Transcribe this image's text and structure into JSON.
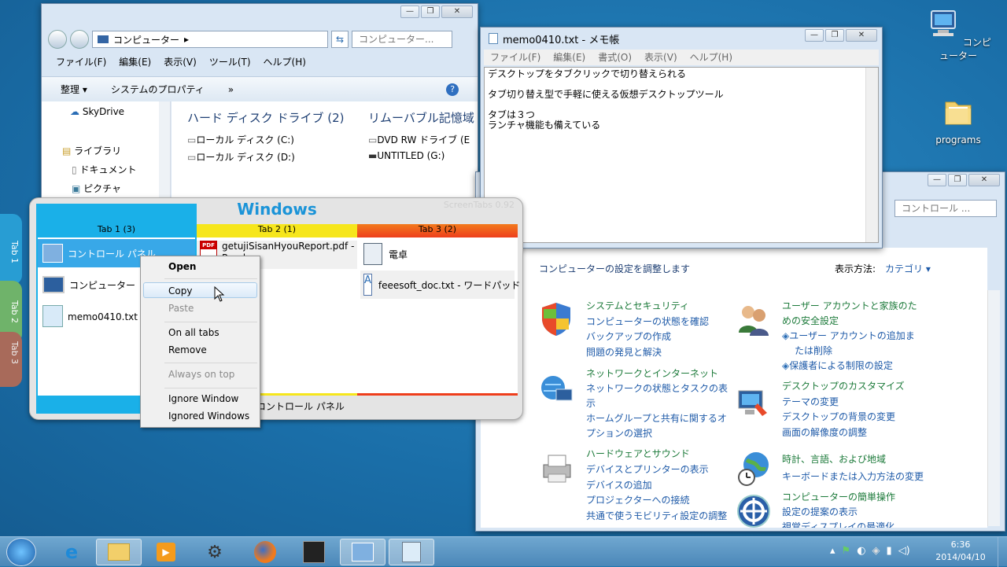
{
  "desktop": {
    "icons": [
      {
        "label": "コンピューター",
        "icon": "computer-icon"
      },
      {
        "label": "programs",
        "icon": "folder-icon"
      }
    ]
  },
  "explorer": {
    "address": "コンピューター",
    "address_arrow": "▸",
    "search_placeholder": "コンピューター...",
    "menu": [
      "ファイル(F)",
      "編集(E)",
      "表示(V)",
      "ツール(T)",
      "ヘルプ(H)"
    ],
    "toolbar": {
      "organize": "整理 ▾",
      "system_props": "システムのプロパティ",
      "more": "»"
    },
    "nav": [
      "SkyDrive",
      "ライブラリ",
      "ドキュメント",
      "ピクチャ"
    ],
    "groups": [
      {
        "title": "ハード ディスク ドライブ (2)",
        "items": [
          "ローカル ディスク (C:)",
          "ローカル ディスク (D:)"
        ]
      },
      {
        "title": "リムーバブル記憶域",
        "items": [
          "DVD RW ドライブ (E",
          "UNTITLED (G:)"
        ]
      }
    ]
  },
  "notepad": {
    "title": "memo0410.txt - メモ帳",
    "menu": [
      "ファイル(F)",
      "編集(E)",
      "書式(O)",
      "表示(V)",
      "ヘルプ(H)"
    ],
    "lines": [
      "デスクトップをタブクリックで切り替えられる",
      "",
      "タブ切り替え型で手軽に使える仮想デスクトップツール",
      "",
      "タブは３つ",
      "ランチャ機能も備えている"
    ]
  },
  "control_panel": {
    "search_placeholder": "コントロール ...",
    "heading": "コンピューターの設定を調整します",
    "view_label": "表示方法:",
    "view_value": "カテゴリ ▾",
    "left": [
      {
        "title": "システムとセキュリティ",
        "links": [
          "コンピューターの状態を確認",
          "バックアップの作成",
          "問題の発見と解決"
        ]
      },
      {
        "title": "ネットワークとインターネット",
        "links": [
          "ネットワークの状態とタスクの表",
          "示",
          "ホームグループと共有に関するオ",
          "プションの選択"
        ]
      },
      {
        "title": "ハードウェアとサウンド",
        "links": [
          "デバイスとプリンターの表示",
          "デバイスの追加",
          "プロジェクターへの接続",
          "共通で使うモビリティ設定の調整"
        ]
      }
    ],
    "right": [
      {
        "title": "ユーザー アカウントと家族のた",
        "title2": "めの安全設定",
        "links": [
          "ユーザー アカウントの追加ま",
          "たは削除",
          "保護者による制限の設定"
        ]
      },
      {
        "title": "デスクトップのカスタマイズ",
        "links": [
          "テーマの変更",
          "デスクトップの背景の変更",
          "画面の解像度の調整"
        ]
      },
      {
        "title": "時計、言語、および地域",
        "links": [
          "キーボードまたは入力方法の変更"
        ]
      },
      {
        "title": "コンピューターの簡単操作",
        "links": [
          "設定の提案の表示",
          "視覚ディスプレイの最適化"
        ]
      }
    ]
  },
  "screentabs": {
    "title": "Windows",
    "version": "ScreenTabs 0.92",
    "tabs": [
      {
        "label": "Tab 1 (3)",
        "color": "#1ab0e8",
        "items": [
          "コントロール パネル",
          "コンピューター",
          "memo0410.txt - メ"
        ]
      },
      {
        "label": "Tab 2 (1)",
        "color": "#f6e61c",
        "items": [
          "getujiSisanHyouReport.pdf -",
          "Reader"
        ]
      },
      {
        "label": "Tab 3 (2)",
        "color": "#f2501c",
        "items": [
          "電卓",
          "feeesoft_doc.txt - ワードパッド"
        ]
      }
    ],
    "status": "コントロール パネル"
  },
  "context_menu": {
    "items": [
      "Open",
      "Copy",
      "Paste",
      "On all tabs",
      "Remove",
      "Always on top",
      "Ignore Window",
      "Ignored Windows"
    ]
  },
  "side_tabs": [
    "Tab 1",
    "Tab 2",
    "Tab 3"
  ],
  "taskbar": {
    "time": "6:36",
    "date": "2014/04/10"
  }
}
